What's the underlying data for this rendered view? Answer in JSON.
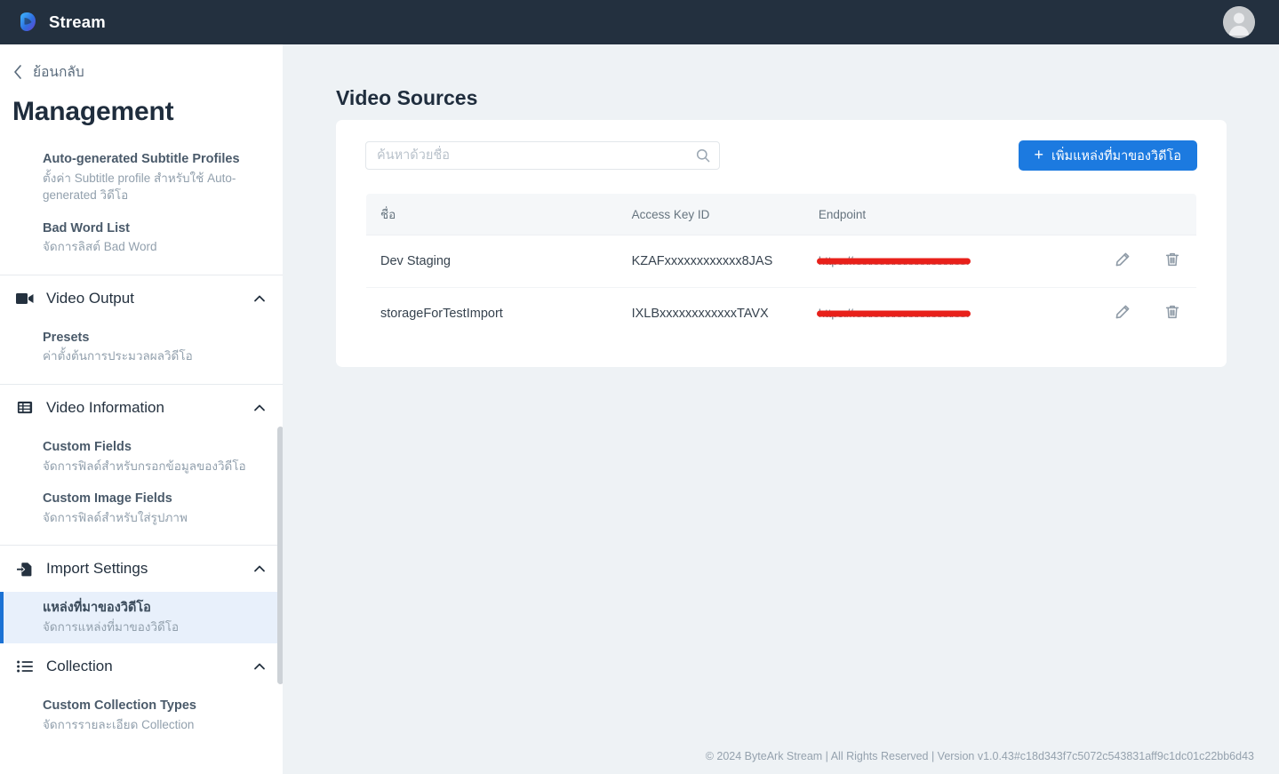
{
  "topbar": {
    "brand_name": "Stream",
    "logo_icon": "stream-droplet-logo",
    "avatar_icon": "user-avatar-icon"
  },
  "sidebar": {
    "back_label": "ย้อนกลับ",
    "back_icon": "chevron-left-icon",
    "heading": "Management",
    "top_items": [
      {
        "title": "Auto-generated Subtitle Profiles",
        "desc": "ตั้งค่า Subtitle profile สำหรับใช้ Auto-generated วิดีโอ"
      },
      {
        "title": "Bad Word List",
        "desc": "จัดการลิสต์ Bad Word"
      }
    ],
    "groups": [
      {
        "label": "Video Output",
        "icon": "video-camera-icon",
        "caret": "chevron-up-icon",
        "items": [
          {
            "title": "Presets",
            "desc": "ค่าตั้งต้นการประมวลผลวิดีโอ"
          }
        ]
      },
      {
        "label": "Video Information",
        "icon": "table-list-icon",
        "caret": "chevron-up-icon",
        "items": [
          {
            "title": "Custom Fields",
            "desc": "จัดการฟิลด์สำหรับกรอกข้อมูลของวิดีโอ"
          },
          {
            "title": "Custom Image Fields",
            "desc": "จัดการฟิลด์สำหรับใส่รูปภาพ"
          }
        ]
      },
      {
        "label": "Import Settings",
        "icon": "file-import-icon",
        "caret": "chevron-up-icon",
        "items": [
          {
            "title": "แหล่งที่มาของวิดีโอ",
            "desc": "จัดการแหล่งที่มาของวิดีโอ",
            "active": true
          }
        ]
      },
      {
        "label": "Collection",
        "icon": "list-icon",
        "caret": "chevron-up-icon",
        "items": [
          {
            "title": "Custom Collection Types",
            "desc": "จัดการรายละเอียด Collection"
          }
        ]
      }
    ]
  },
  "main": {
    "title": "Video Sources",
    "search": {
      "placeholder": "ค้นหาด้วยชื่อ",
      "value": "",
      "icon": "search-icon"
    },
    "add_button": {
      "label": "เพิ่มแหล่งที่มาของวิดีโอ",
      "icon": "plus-icon"
    },
    "table": {
      "columns": [
        "ชื่อ",
        "Access Key ID",
        "Endpoint",
        "",
        ""
      ],
      "rows": [
        {
          "name": "Dev Staging",
          "access_key_id": "KZAFxxxxxxxxxxxx8JAS",
          "endpoint": "https://xxxxxxxxxxxxxxxxxxxx",
          "endpoint_redacted": true,
          "edit_icon": "pencil-icon",
          "delete_icon": "trash-icon"
        },
        {
          "name": "storageForTestImport",
          "access_key_id": "IXLBxxxxxxxxxxxxTAVX",
          "endpoint": "https://xxxxxxxxxxxxxxxxxxxx",
          "endpoint_redacted": true,
          "edit_icon": "pencil-icon",
          "delete_icon": "trash-icon"
        }
      ]
    }
  },
  "footer": {
    "text": "© 2024 ByteArk Stream | All Rights Reserved | Version v1.0.43#c18d343f7c5072c543831aff9c1dc01c22bb6d43"
  },
  "colors": {
    "topbar_bg": "#23303f",
    "accent_blue": "#1c7ae0",
    "active_item_bg": "#e8f0fb",
    "page_bg": "#eef2f5",
    "redaction_red": "#e8201a"
  }
}
